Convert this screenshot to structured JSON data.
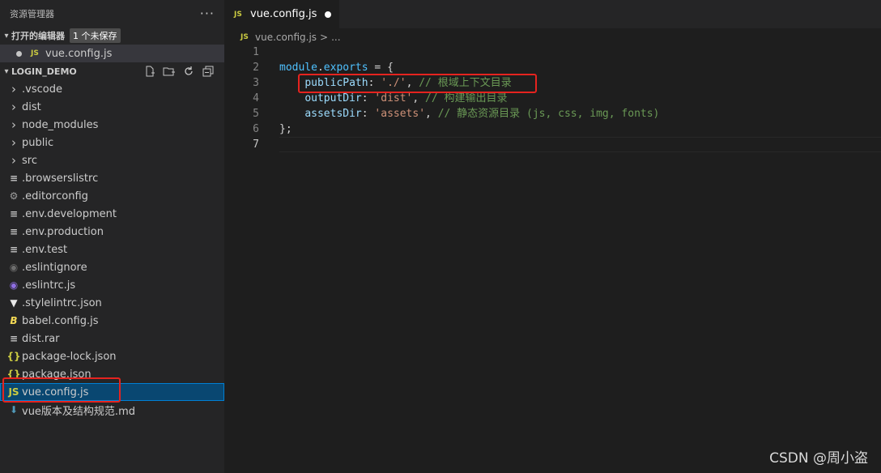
{
  "sidebar": {
    "title": "资源管理器",
    "more": "···",
    "open_editors": {
      "title": "打开的编辑器",
      "badge": "1 个未保存",
      "items": [
        {
          "icon": "JS",
          "label": "vue.config.js"
        }
      ]
    },
    "project": {
      "title": "LOGIN_DEMO",
      "items": [
        {
          "type": "folder",
          "label": ".vscode"
        },
        {
          "type": "folder",
          "label": "dist"
        },
        {
          "type": "folder",
          "label": "node_modules"
        },
        {
          "type": "folder",
          "label": "public"
        },
        {
          "type": "folder",
          "label": "src"
        },
        {
          "type": "file",
          "icon": "lines",
          "label": ".browserslistrc"
        },
        {
          "type": "file",
          "icon": "gear",
          "label": ".editorconfig"
        },
        {
          "type": "file",
          "icon": "lines",
          "label": ".env.development"
        },
        {
          "type": "file",
          "icon": "lines",
          "label": ".env.production"
        },
        {
          "type": "file",
          "icon": "lines",
          "label": ".env.test"
        },
        {
          "type": "file",
          "icon": "eslint-ignore",
          "label": ".eslintignore"
        },
        {
          "type": "file",
          "icon": "eslint",
          "label": ".eslintrc.js"
        },
        {
          "type": "file",
          "icon": "stylelint",
          "label": ".stylelintrc.json"
        },
        {
          "type": "file",
          "icon": "babel",
          "label": "babel.config.js"
        },
        {
          "type": "file",
          "icon": "lines",
          "label": "dist.rar"
        },
        {
          "type": "file",
          "icon": "json",
          "label": "package-lock.json"
        },
        {
          "type": "file",
          "icon": "json",
          "label": "package.json"
        },
        {
          "type": "file",
          "icon": "js",
          "label": "vue.config.js",
          "selected": true
        },
        {
          "type": "file",
          "icon": "markdown",
          "label": "vue版本及结构规范.md"
        }
      ]
    }
  },
  "editor": {
    "tab": {
      "icon": "JS",
      "label": "vue.config.js"
    },
    "breadcrumb": {
      "icon": "JS",
      "file": "vue.config.js",
      "sep": ">",
      "rest": "..."
    },
    "lines": [
      {
        "n": "1",
        "tokens": []
      },
      {
        "n": "2",
        "tokens": [
          {
            "c": "var",
            "t": "module"
          },
          {
            "c": "plain",
            "t": "."
          },
          {
            "c": "var",
            "t": "exports"
          },
          {
            "c": "plain",
            "t": " = {"
          }
        ]
      },
      {
        "n": "3",
        "tokens": [
          {
            "c": "plain",
            "t": "    "
          },
          {
            "c": "prop",
            "t": "publicPath"
          },
          {
            "c": "plain",
            "t": ": "
          },
          {
            "c": "str",
            "t": "'./'"
          },
          {
            "c": "plain",
            "t": ", "
          },
          {
            "c": "com",
            "t": "// 根域上下文目录"
          }
        ]
      },
      {
        "n": "4",
        "tokens": [
          {
            "c": "plain",
            "t": "    "
          },
          {
            "c": "prop",
            "t": "outputDir"
          },
          {
            "c": "plain",
            "t": ": "
          },
          {
            "c": "str",
            "t": "'dist'"
          },
          {
            "c": "plain",
            "t": ", "
          },
          {
            "c": "com",
            "t": "// 构建输出目录"
          }
        ]
      },
      {
        "n": "5",
        "tokens": [
          {
            "c": "plain",
            "t": "    "
          },
          {
            "c": "prop",
            "t": "assetsDir"
          },
          {
            "c": "plain",
            "t": ": "
          },
          {
            "c": "str",
            "t": "'assets'"
          },
          {
            "c": "plain",
            "t": ", "
          },
          {
            "c": "com",
            "t": "// 静态资源目录 (js, css, img, fonts)"
          }
        ]
      },
      {
        "n": "6",
        "tokens": [
          {
            "c": "plain",
            "t": "};"
          }
        ]
      },
      {
        "n": "7",
        "tokens": [],
        "current": true
      }
    ]
  },
  "watermark": "CSDN @周小盗",
  "colors": {
    "selection": "#094771",
    "highlight_box": "#e5231f",
    "js_icon": "#cbcb41"
  }
}
